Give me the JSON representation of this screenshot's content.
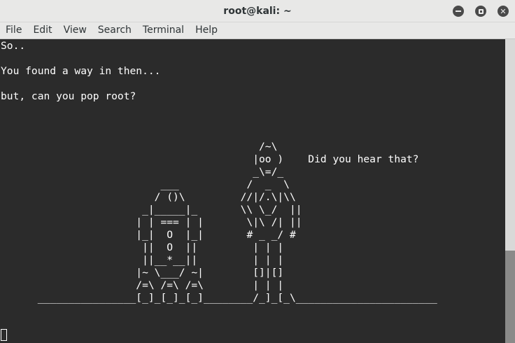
{
  "window": {
    "title": "root@kali: ~"
  },
  "menubar": {
    "items": [
      "File",
      "Edit",
      "View",
      "Search",
      "Terminal",
      "Help"
    ]
  },
  "terminal": {
    "text": "So..\n\nYou found a way in then...\n\nbut, can you pop root?\n\n\n\n                                          /~\\\n                                         |oo )    Did you hear that?\n                                         _\\=/_\n                          ___           /  _  \\\n                         / ()\\         //|/.\\|\\\\\n                       _|_____|_       \\\\ \\_/  ||\n                      | | === | |       \\|\\ /| ||\n                      |_|  O  |_|       # _ _/ #\n                       ||  O  ||         | | |\n                       ||__*__||         | | |\n                      |~ \\___/ ~|        []|[]\n                      /=\\ /=\\ /=\\        | | |\n      ________________[_]_[_]_[_]________/_]_[_\\_______________________",
    "colors": {
      "background": "#2b2b2b",
      "foreground": "#ffffff"
    }
  },
  "scrollbar": {
    "position": 0.7
  }
}
